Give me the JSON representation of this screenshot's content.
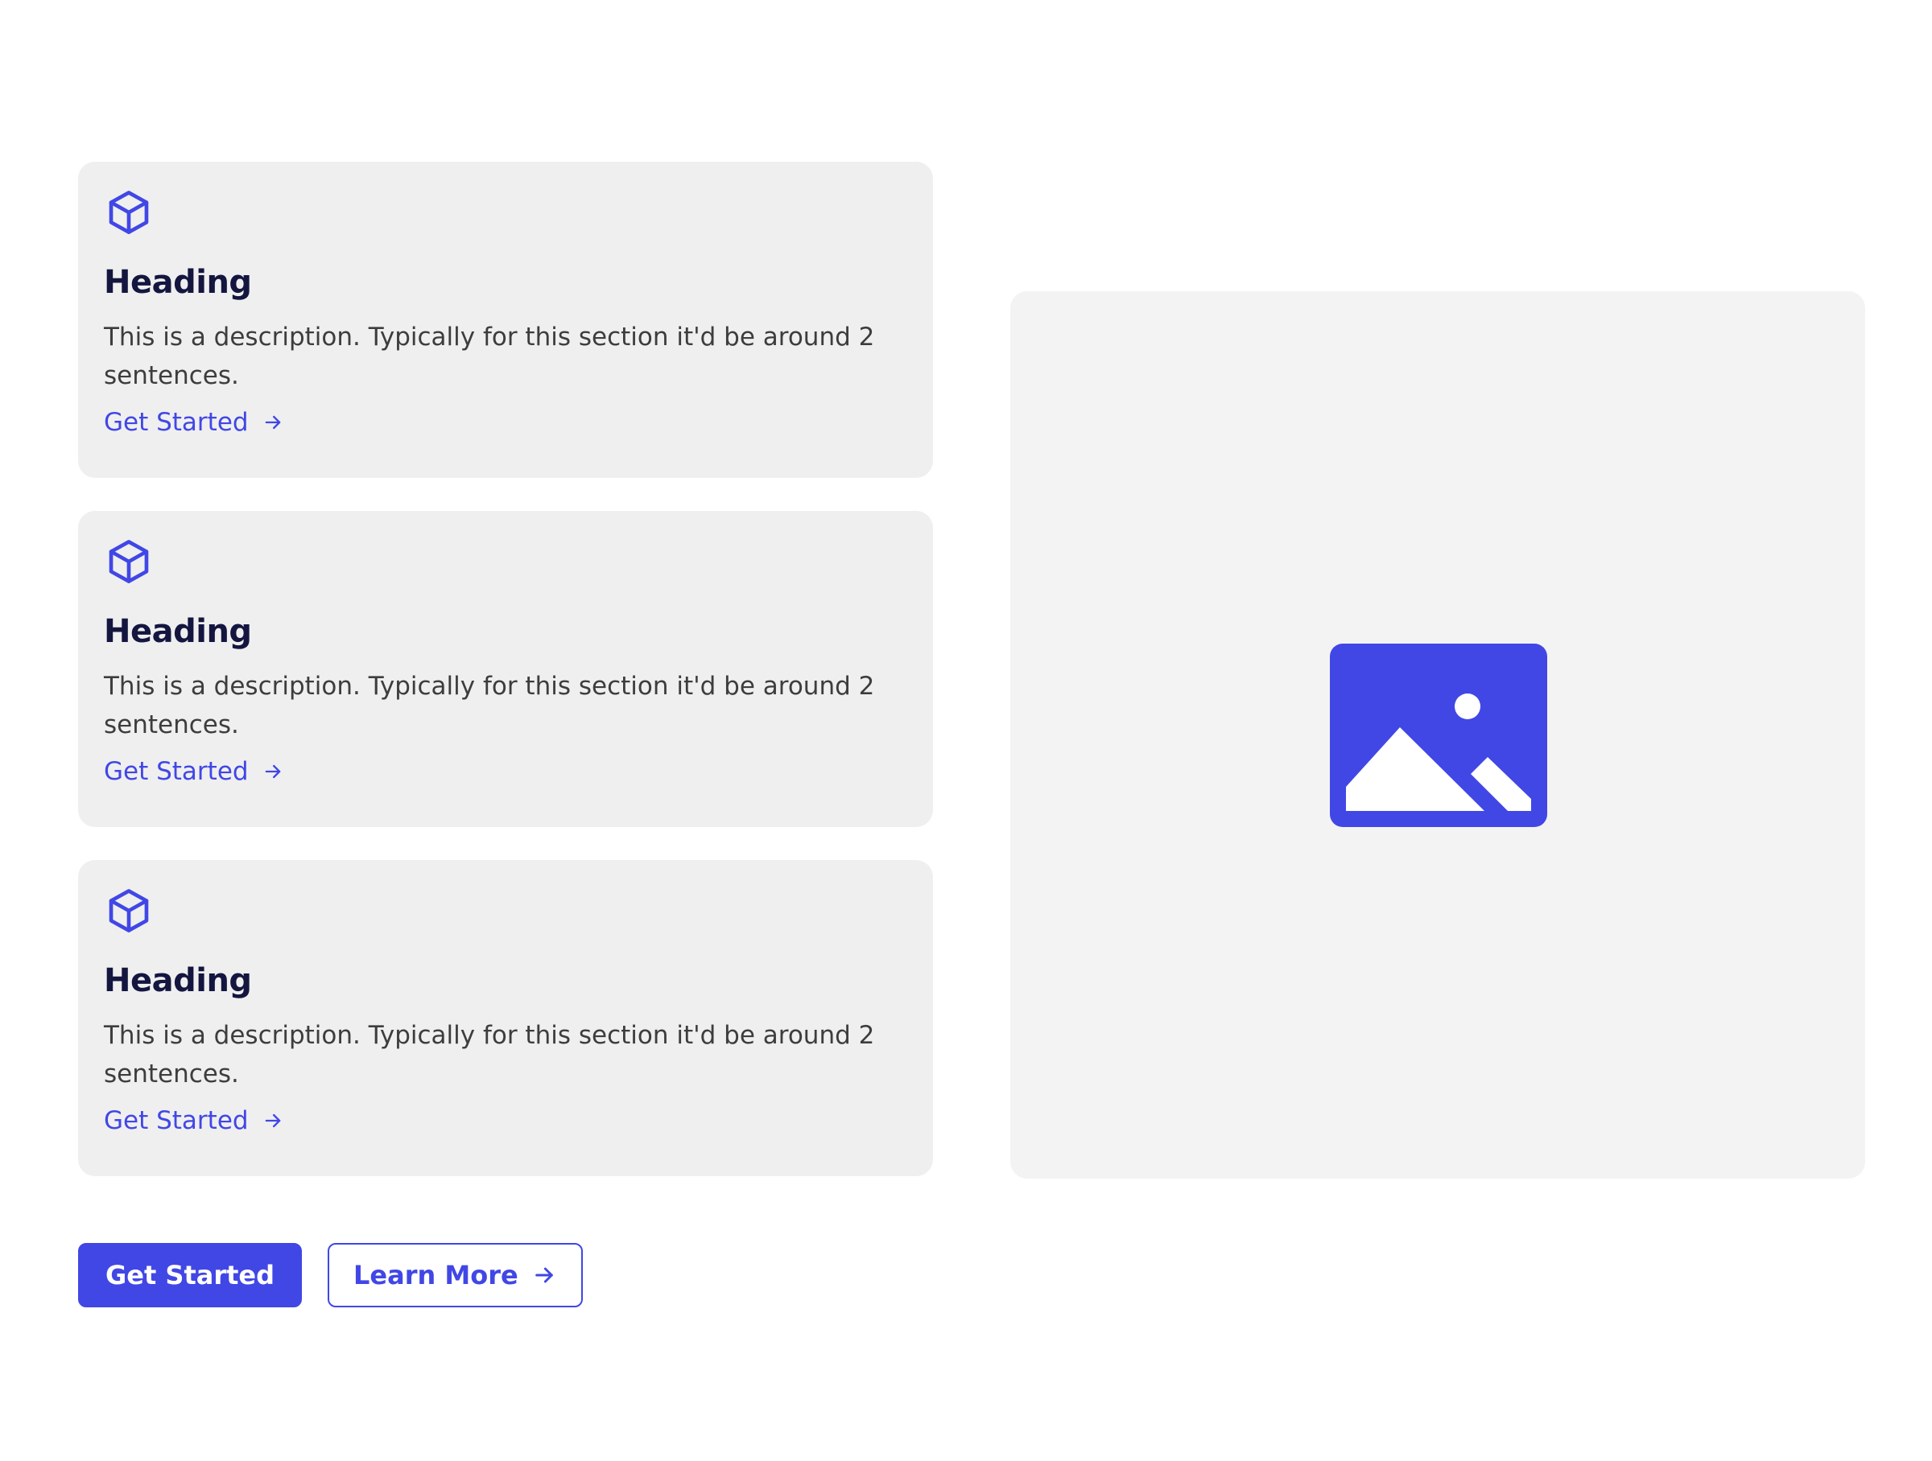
{
  "colors": {
    "accent": "#4147e5",
    "heading": "#141640",
    "body_text": "#3d3d3d",
    "card_bg": "#efefef",
    "image_bg": "#f3f3f3"
  },
  "cards": [
    {
      "icon": "cube-icon",
      "heading": "Heading",
      "description": "This is a description. Typically for this section it'd be around 2 sentences.",
      "link_label": "Get Started",
      "link_icon": "arrow-right-icon"
    },
    {
      "icon": "cube-icon",
      "heading": "Heading",
      "description": "This is a description. Typically for this section it'd be around 2 sentences.",
      "link_label": "Get Started",
      "link_icon": "arrow-right-icon"
    },
    {
      "icon": "cube-icon",
      "heading": "Heading",
      "description": "This is a description. Typically for this section it'd be around 2 sentences.",
      "link_label": "Get Started",
      "link_icon": "arrow-right-icon"
    }
  ],
  "image_panel": {
    "icon": "image-placeholder-icon"
  },
  "actions": {
    "primary_label": "Get Started",
    "secondary_label": "Learn More",
    "secondary_icon": "arrow-right-icon"
  }
}
